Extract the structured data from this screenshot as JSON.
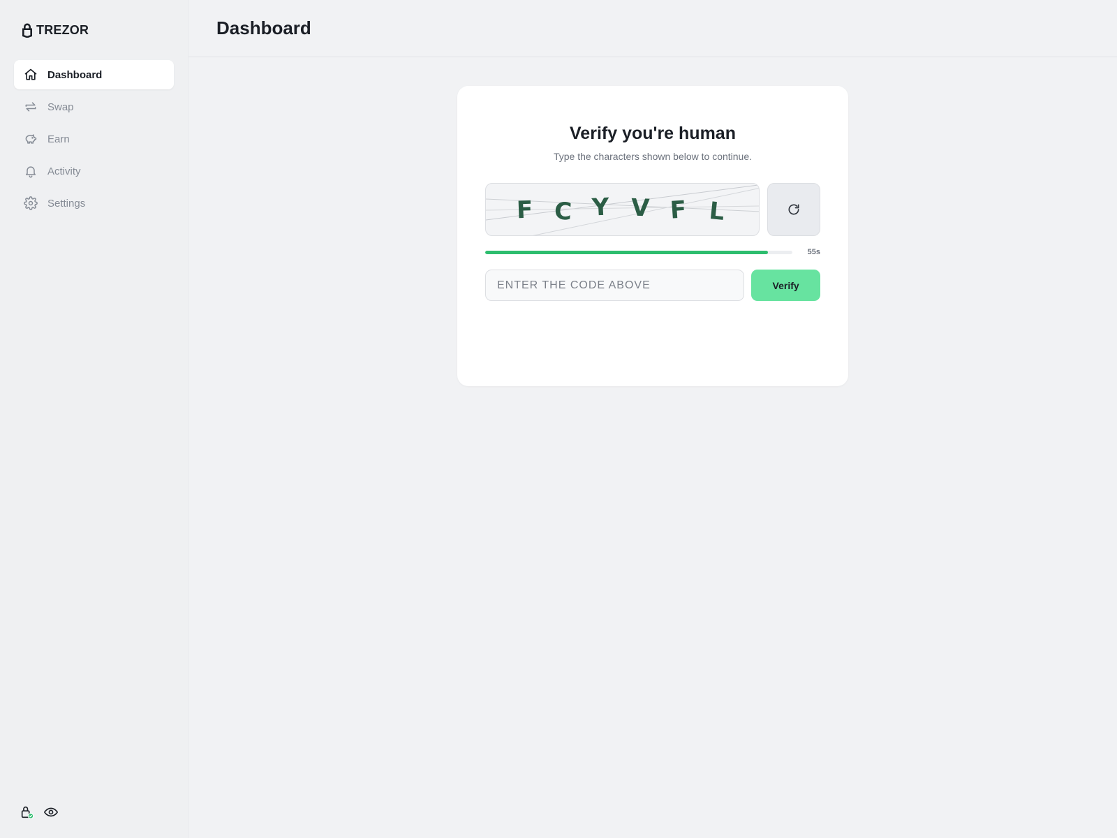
{
  "app": {
    "brand": "TREZOR"
  },
  "sidebar": {
    "items": [
      {
        "label": "Dashboard",
        "icon": "home-icon",
        "active": true
      },
      {
        "label": "Swap",
        "icon": "swap-arrows-icon",
        "active": false
      },
      {
        "label": "Earn",
        "icon": "piggy-bank-icon",
        "active": false
      },
      {
        "label": "Activity",
        "icon": "bell-icon",
        "active": false
      },
      {
        "label": "Settings",
        "icon": "gear-icon",
        "active": false
      }
    ],
    "footer_icons": [
      "lock-check-icon",
      "eye-icon"
    ]
  },
  "header": {
    "title": "Dashboard"
  },
  "captcha": {
    "title": "Verify you're human",
    "subtitle": "Type the characters shown below to continue.",
    "characters": [
      "F",
      "C",
      "Y",
      "V",
      "F",
      "L"
    ],
    "refresh_icon": "refresh-icon",
    "timer_label": "55s",
    "timer_progress": 0.92,
    "input_placeholder": "ENTER THE CODE ABOVE",
    "input_value": "",
    "verify_label": "Verify"
  },
  "colors": {
    "accent": "#2dbd6e",
    "verify_button": "#67e3a0",
    "captcha_text": "#2b5d45",
    "background": "#f1f2f4"
  }
}
